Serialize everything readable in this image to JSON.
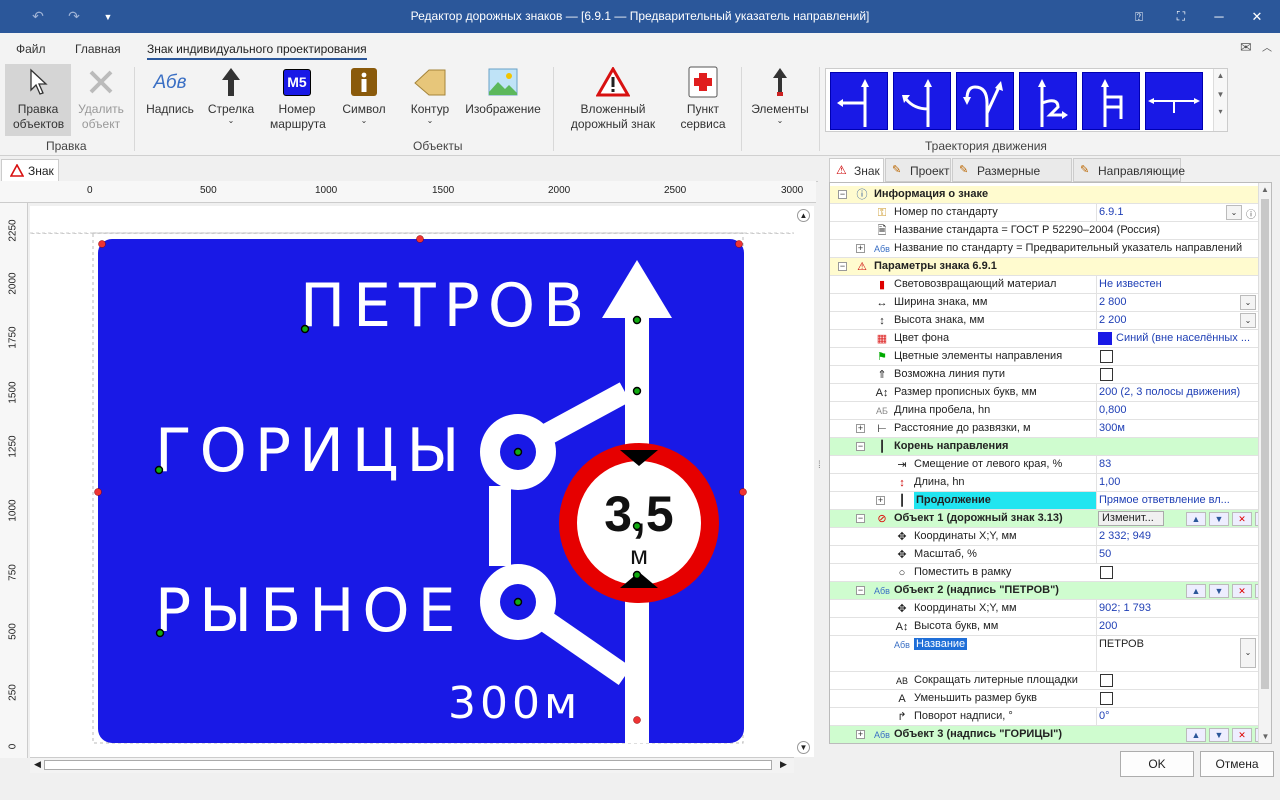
{
  "window": {
    "title": "Редактор дорожных знаков — [6.9.1 — Предварительный указатель направлений]"
  },
  "menu": {
    "file": "Файл",
    "home": "Главная",
    "custom": "Знак индивидуального проектирования"
  },
  "ribbon": {
    "edit_objects": "Правка объектов",
    "delete_object": "Удалить объект",
    "group_edit": "Правка",
    "label": "Надпись",
    "arrow": "Стрелка",
    "route_number": "Номер маршрута",
    "symbol": "Символ",
    "contour": "Контур",
    "image": "Изображение",
    "nested_sign": "Вложенный дорожный знак",
    "service_point": "Пункт сервиса",
    "group_objects": "Объекты",
    "elements": "Элементы",
    "group_trajectory": "Траектория движения",
    "route_badge": "M5",
    "label_icon_text": "Абв"
  },
  "doc_tab": "Знак",
  "ruler": {
    "h": [
      "0",
      "500",
      "1000",
      "1500",
      "2000",
      "2500",
      "3000"
    ],
    "v": [
      "2250",
      "2000",
      "1750",
      "1500",
      "1250",
      "1000",
      "750",
      "500",
      "250",
      "0"
    ]
  },
  "sign": {
    "line1": "ПЕТРОВ",
    "line2": "ГОРИЦЫ",
    "line3": "РЫБНОЕ",
    "distance": "300м",
    "limit_value": "3,5",
    "limit_unit": "м"
  },
  "colors": {
    "sign_blue": "#1919e6",
    "title_blue": "#2b579a",
    "section_yellow": "#fffbcf",
    "section_green": "#cffccf",
    "cyan": "#22e5f0"
  },
  "right_tabs": [
    "Знак",
    "Проект",
    "Размерные линии",
    "Направляющие"
  ],
  "props": {
    "info": "Информация о знаке",
    "std_number": "Номер по стандарту",
    "std_number_val": "6.9.1",
    "std_name": "Название стандарта = ГОСТ Р 52290–2004 (Россия)",
    "std_title": "Название по стандарту = Предварительный указатель направлений",
    "params": "Параметры знака 6.9.1",
    "material": "Световозвращающий материал",
    "material_val": "Не известен",
    "width": "Ширина знака, мм",
    "width_val": "2 800",
    "height": "Высота знака, мм",
    "height_val": "2 200",
    "bg": "Цвет фона",
    "bg_val": "Синий (вне населённых ...",
    "colored": "Цветные элементы направления",
    "path": "Возможна линия пути",
    "caps": "Размер прописных букв, мм",
    "caps_val": "200 (2, 3 полосы движения)",
    "space": "Длина пробела, hn",
    "space_val": "0,800",
    "dist": "Расстояние до развязки, м",
    "dist_val": "300м",
    "root": "Корень направления",
    "offset": "Смещение от левого края, %",
    "offset_val": "83",
    "length": "Длина, hn",
    "length_val": "1,00",
    "cont": "Продолжение",
    "cont_val": "Прямое ответвление вл...",
    "obj1": "Объект 1 (дорожный знак 3.13)",
    "change": "Изменит...",
    "coords": "Координаты X;Y, мм",
    "obj1_coords": "2 332; 949",
    "scale": "Масштаб, %",
    "scale_val": "50",
    "fit": "Поместить в рамку",
    "obj2": "Объект 2 (надпись \"ПЕТРОВ\")",
    "obj2_coords": "902; 1 793",
    "letter_h": "Высота букв, мм",
    "letter_h_val": "200",
    "name": "Название",
    "name_val": "ПЕТРОВ",
    "shrink": "Сокращать литерные площадки",
    "reduce": "Уменьшить размер букв",
    "rotate": "Поворот надписи, °",
    "rotate_val": "0°",
    "obj3": "Объект 3 (надпись \"ГОРИЦЫ\")"
  },
  "buttons": {
    "ok": "OK",
    "cancel": "Отмена"
  }
}
